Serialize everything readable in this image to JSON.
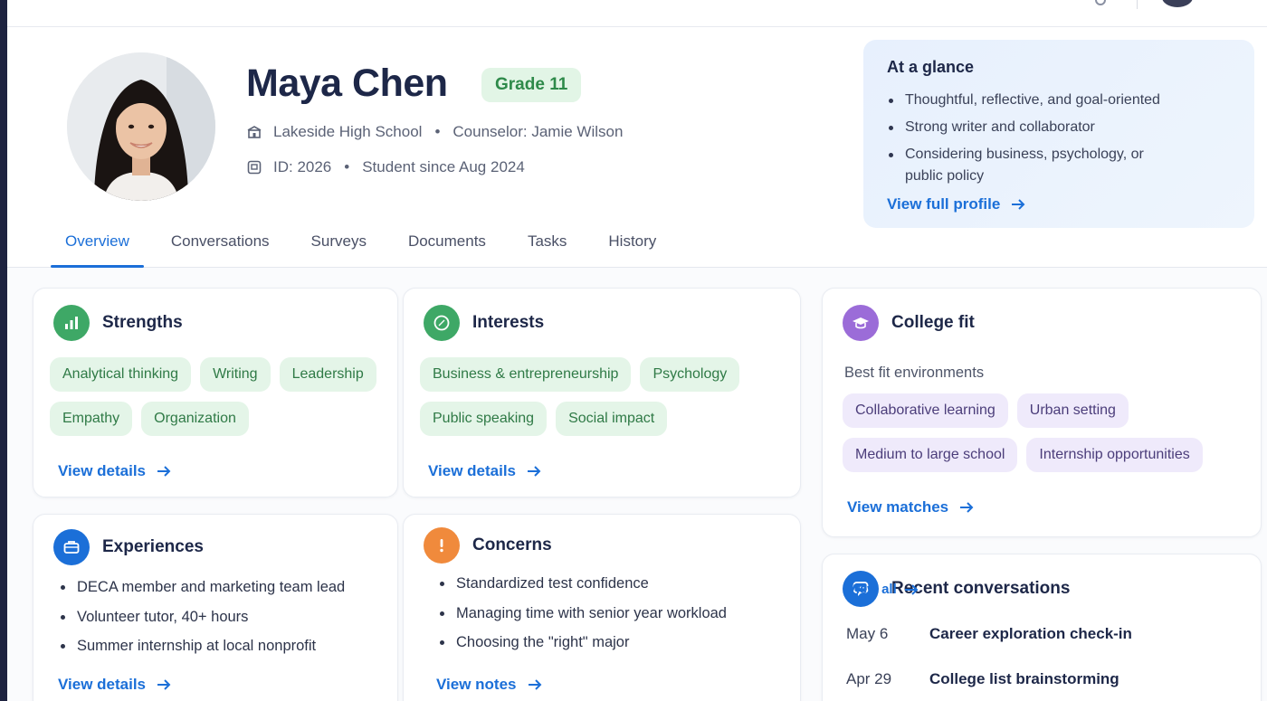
{
  "student": {
    "name": "Maya Chen",
    "grade": "Grade 11",
    "school": "Lakeside High School",
    "counselor": "Counselor: Jamie Wilson",
    "id": "ID: 2026",
    "since": "Student since Aug 2024"
  },
  "glance": {
    "title": "At a glance",
    "items": [
      "Thoughtful, reflective, and goal-oriented",
      "Strong writer and collaborator",
      "Considering business, psychology, or public policy"
    ],
    "link": "View full profile"
  },
  "tabs": [
    "Overview",
    "Conversations",
    "Surveys",
    "Documents",
    "Tasks",
    "History"
  ],
  "strengths": {
    "title": "Strengths",
    "chips": [
      "Analytical thinking",
      "Writing",
      "Leadership",
      "Empathy",
      "Organization"
    ],
    "link": "View details"
  },
  "interests": {
    "title": "Interests",
    "chips": [
      "Business & entrepreneurship",
      "Psychology",
      "Public speaking",
      "Social impact"
    ],
    "link": "View details"
  },
  "college_fit": {
    "title": "College fit",
    "subtitle": "Best fit environments",
    "chips": [
      "Collaborative learning",
      "Urban setting",
      "Medium to large school",
      "Internship opportunities"
    ],
    "link": "View matches"
  },
  "experiences": {
    "title": "Experiences",
    "items": [
      "DECA member and marketing team lead",
      "Volunteer tutor, 40+ hours",
      "Summer internship at local nonprofit"
    ],
    "link": "View details"
  },
  "concerns": {
    "title": "Concerns",
    "items": [
      "Standardized test confidence",
      "Managing time with senior year workload",
      "Choosing the \"right\" major"
    ],
    "link": "View notes"
  },
  "recent_conversations": {
    "title": "Recent conversations",
    "view_all": "View all",
    "rows": [
      {
        "date": "May 6",
        "topic": "Career exploration check-in"
      },
      {
        "date": "Apr 29",
        "topic": "College list brainstorming"
      }
    ]
  },
  "colors": {
    "accent": "#1b6fd8",
    "strengths_icon": "#3ea866",
    "interests_icon": "#3ea866",
    "college_icon": "#9b6cd8",
    "experiences_icon": "#1b6fd8",
    "concerns_icon": "#f08a3c",
    "conversations_icon": "#1b6fd8"
  },
  "icons": {
    "strengths": "bar-chart-icon",
    "interests": "compass-icon",
    "college_fit": "graduation-cap-icon",
    "experiences": "briefcase-icon",
    "concerns": "exclamation-icon",
    "conversations": "chat-icon"
  }
}
